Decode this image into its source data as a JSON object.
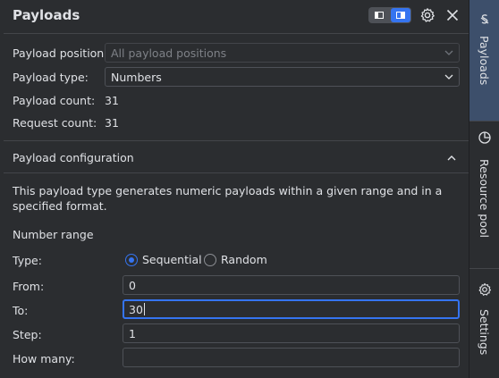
{
  "header": {
    "title": "Payloads",
    "layout_toggle": {
      "selected": "right"
    }
  },
  "fields": {
    "position_label": "Payload position:",
    "position_value": "All payload positions",
    "type_label": "Payload type:",
    "type_value": "Numbers",
    "count_label": "Payload count:",
    "count_value": "31",
    "request_label": "Request count:",
    "request_value": "31"
  },
  "config": {
    "title": "Payload configuration",
    "description": "This payload type generates numeric payloads within a given range and in a specified format.",
    "number_range": "Number range",
    "type_label": "Type:",
    "radios": [
      {
        "label": "Sequential",
        "selected": true
      },
      {
        "label": "Random",
        "selected": false
      }
    ],
    "from_label": "From:",
    "from_value": "0",
    "to_label": "To:",
    "to_value": "30",
    "step_label": "Step:",
    "step_value": "1",
    "howmany_label": "How many:",
    "howmany_value": ""
  },
  "sidebar": {
    "tabs": [
      {
        "label": "Payloads",
        "icon": "payloads-icon",
        "active": true
      },
      {
        "label": "Resource pool",
        "icon": "resource-pool-icon",
        "active": false
      },
      {
        "label": "Settings",
        "icon": "gear-icon",
        "active": false
      }
    ]
  },
  "colors": {
    "background": "#2b2d30",
    "accent": "#3574f0",
    "border": "#4e5157",
    "text": "#dfe1e5",
    "active_tab": "#3d4f6b"
  }
}
